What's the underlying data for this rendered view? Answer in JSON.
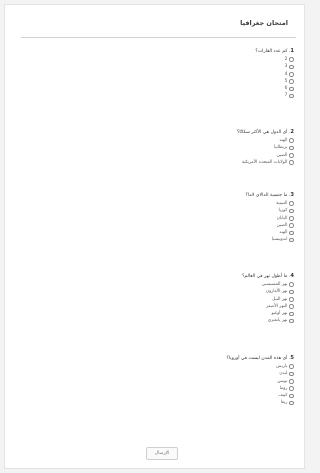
{
  "form": {
    "title": "امتحان جغرافيا",
    "submit_label": "الإرسال"
  },
  "questions": [
    {
      "number": "1",
      "text": ". كم عدد القارات؟",
      "options": [
        "2",
        "3",
        "4",
        "5",
        "6",
        "7"
      ]
    },
    {
      "number": "2",
      "text": ". أي الدول هي الأكثر سكانًا؟",
      "options": [
        "الهند",
        "بريطانيا",
        "الصين",
        "الولايات المتحدة الأمريكية"
      ]
    },
    {
      "number": "3",
      "text": ". ما جنسية الدالاي لاما؟",
      "options": [
        "التبيتية",
        "كوريا",
        "اليابان",
        "الصين",
        "الهند",
        "اندونيسيا"
      ]
    },
    {
      "number": "4",
      "text": ". ما أطول نهر في العالم؟",
      "options": [
        "نهر المسيسبي",
        "نهر الأمازون",
        "نهر النيل",
        "النهر الأصفر",
        "نهر أوغبو",
        "نهر يانغتزي"
      ]
    },
    {
      "number": "5",
      "text": ". أي هذه المدن ليست في أوروبا؟",
      "options": [
        "باريس",
        "لندن",
        "تونس",
        "روما",
        "كييف",
        "ريغا"
      ]
    }
  ]
}
